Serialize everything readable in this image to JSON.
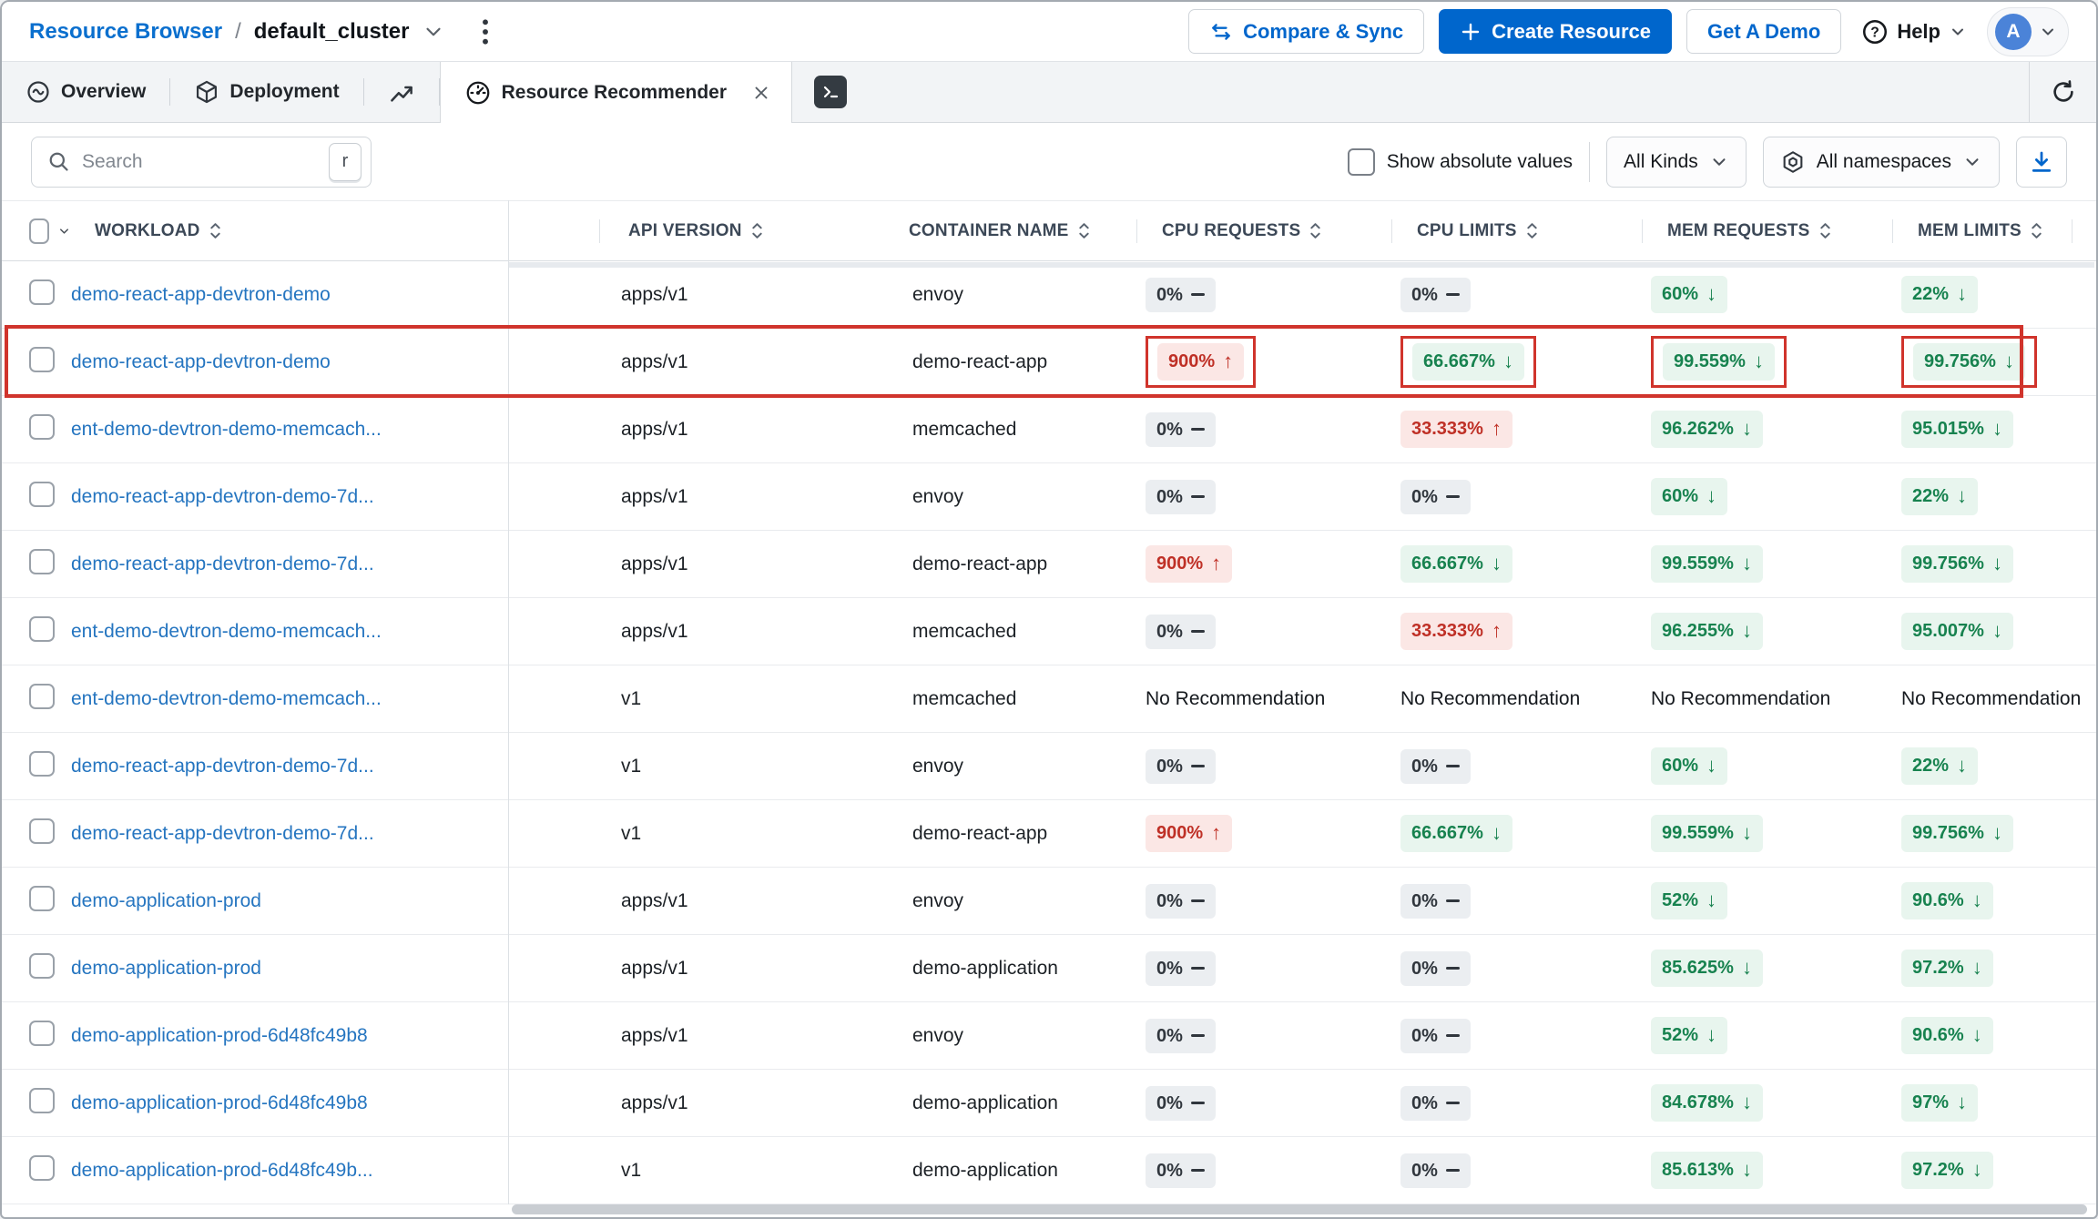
{
  "topbar": {
    "breadcrumb": {
      "root": "Resource Browser",
      "separator": "/",
      "current": "default_cluster"
    },
    "compare_sync_label": "Compare & Sync",
    "create_resource_label": "Create Resource",
    "get_demo_label": "Get A Demo",
    "help_label": "Help",
    "avatar_initial": "A"
  },
  "tabs": {
    "overview": "Overview",
    "deployment": "Deployment",
    "recommender": "Resource Recommender"
  },
  "filters": {
    "search_placeholder": "Search",
    "search_shortcut_key": "r",
    "show_absolute_values_label": "Show absolute values",
    "kinds_dropdown": "All Kinds",
    "namespaces_dropdown": "All namespaces"
  },
  "table": {
    "columns": [
      "WORKLOAD",
      "API VERSION",
      "CONTAINER NAME",
      "CPU REQUESTS",
      "CPU LIMITS",
      "MEM REQUESTS",
      "MEM LIMITS"
    ],
    "no_recommendation_label": "No Recommendation",
    "rows": [
      {
        "workload": "demo-react-app-devtron-demo",
        "api_version": "apps/v1",
        "container": "envoy",
        "cpu_requests": {
          "v": "0%",
          "t": "flat"
        },
        "cpu_limits": {
          "v": "0%",
          "t": "flat"
        },
        "mem_requests": {
          "v": "60%",
          "t": "down"
        },
        "mem_limits": {
          "v": "22%",
          "t": "down"
        },
        "highlighted": false
      },
      {
        "workload": "demo-react-app-devtron-demo",
        "api_version": "apps/v1",
        "container": "demo-react-app",
        "cpu_requests": {
          "v": "900%",
          "t": "up"
        },
        "cpu_limits": {
          "v": "66.667%",
          "t": "down"
        },
        "mem_requests": {
          "v": "99.559%",
          "t": "down"
        },
        "mem_limits": {
          "v": "99.756%",
          "t": "down"
        },
        "highlighted": true
      },
      {
        "workload": "ent-demo-devtron-demo-memcach...",
        "api_version": "apps/v1",
        "container": "memcached",
        "cpu_requests": {
          "v": "0%",
          "t": "flat"
        },
        "cpu_limits": {
          "v": "33.333%",
          "t": "up"
        },
        "mem_requests": {
          "v": "96.262%",
          "t": "down"
        },
        "mem_limits": {
          "v": "95.015%",
          "t": "down"
        },
        "highlighted": false
      },
      {
        "workload": "demo-react-app-devtron-demo-7d...",
        "api_version": "apps/v1",
        "container": "envoy",
        "cpu_requests": {
          "v": "0%",
          "t": "flat"
        },
        "cpu_limits": {
          "v": "0%",
          "t": "flat"
        },
        "mem_requests": {
          "v": "60%",
          "t": "down"
        },
        "mem_limits": {
          "v": "22%",
          "t": "down"
        },
        "highlighted": false
      },
      {
        "workload": "demo-react-app-devtron-demo-7d...",
        "api_version": "apps/v1",
        "container": "demo-react-app",
        "cpu_requests": {
          "v": "900%",
          "t": "up"
        },
        "cpu_limits": {
          "v": "66.667%",
          "t": "down"
        },
        "mem_requests": {
          "v": "99.559%",
          "t": "down"
        },
        "mem_limits": {
          "v": "99.756%",
          "t": "down"
        },
        "highlighted": false
      },
      {
        "workload": "ent-demo-devtron-demo-memcach...",
        "api_version": "apps/v1",
        "container": "memcached",
        "cpu_requests": {
          "v": "0%",
          "t": "flat"
        },
        "cpu_limits": {
          "v": "33.333%",
          "t": "up"
        },
        "mem_requests": {
          "v": "96.255%",
          "t": "down"
        },
        "mem_limits": {
          "v": "95.007%",
          "t": "down"
        },
        "highlighted": false
      },
      {
        "workload": "ent-demo-devtron-demo-memcach...",
        "api_version": "v1",
        "container": "memcached",
        "cpu_requests": {
          "v": "",
          "t": "none"
        },
        "cpu_limits": {
          "v": "",
          "t": "none"
        },
        "mem_requests": {
          "v": "",
          "t": "none"
        },
        "mem_limits": {
          "v": "",
          "t": "none"
        },
        "highlighted": false
      },
      {
        "workload": "demo-react-app-devtron-demo-7d...",
        "api_version": "v1",
        "container": "envoy",
        "cpu_requests": {
          "v": "0%",
          "t": "flat"
        },
        "cpu_limits": {
          "v": "0%",
          "t": "flat"
        },
        "mem_requests": {
          "v": "60%",
          "t": "down"
        },
        "mem_limits": {
          "v": "22%",
          "t": "down"
        },
        "highlighted": false
      },
      {
        "workload": "demo-react-app-devtron-demo-7d...",
        "api_version": "v1",
        "container": "demo-react-app",
        "cpu_requests": {
          "v": "900%",
          "t": "up"
        },
        "cpu_limits": {
          "v": "66.667%",
          "t": "down"
        },
        "mem_requests": {
          "v": "99.559%",
          "t": "down"
        },
        "mem_limits": {
          "v": "99.756%",
          "t": "down"
        },
        "highlighted": false
      },
      {
        "workload": "demo-application-prod",
        "api_version": "apps/v1",
        "container": "envoy",
        "cpu_requests": {
          "v": "0%",
          "t": "flat"
        },
        "cpu_limits": {
          "v": "0%",
          "t": "flat"
        },
        "mem_requests": {
          "v": "52%",
          "t": "down"
        },
        "mem_limits": {
          "v": "90.6%",
          "t": "down"
        },
        "highlighted": false
      },
      {
        "workload": "demo-application-prod",
        "api_version": "apps/v1",
        "container": "demo-application",
        "cpu_requests": {
          "v": "0%",
          "t": "flat"
        },
        "cpu_limits": {
          "v": "0%",
          "t": "flat"
        },
        "mem_requests": {
          "v": "85.625%",
          "t": "down"
        },
        "mem_limits": {
          "v": "97.2%",
          "t": "down"
        },
        "highlighted": false
      },
      {
        "workload": "demo-application-prod-6d48fc49b8",
        "api_version": "apps/v1",
        "container": "envoy",
        "cpu_requests": {
          "v": "0%",
          "t": "flat"
        },
        "cpu_limits": {
          "v": "0%",
          "t": "flat"
        },
        "mem_requests": {
          "v": "52%",
          "t": "down"
        },
        "mem_limits": {
          "v": "90.6%",
          "t": "down"
        },
        "highlighted": false
      },
      {
        "workload": "demo-application-prod-6d48fc49b8",
        "api_version": "apps/v1",
        "container": "demo-application",
        "cpu_requests": {
          "v": "0%",
          "t": "flat"
        },
        "cpu_limits": {
          "v": "0%",
          "t": "flat"
        },
        "mem_requests": {
          "v": "84.678%",
          "t": "down"
        },
        "mem_limits": {
          "v": "97%",
          "t": "down"
        },
        "highlighted": false
      },
      {
        "workload": "demo-application-prod-6d48fc49b...",
        "api_version": "v1",
        "container": "demo-application",
        "cpu_requests": {
          "v": "0%",
          "t": "flat"
        },
        "cpu_limits": {
          "v": "0%",
          "t": "flat"
        },
        "mem_requests": {
          "v": "85.613%",
          "t": "down"
        },
        "mem_limits": {
          "v": "97.2%",
          "t": "down"
        },
        "highlighted": false
      }
    ]
  },
  "icons": {
    "trend_up": "↑",
    "trend_down": "↓",
    "trend_flat": "—",
    "search": "magnifier",
    "sort": "up-down-chevrons",
    "more_options": "kebab-dots",
    "close": "x-cross"
  },
  "colors": {
    "primary_blue": "#0066cc",
    "link_blue": "#2575c0",
    "trend_up_red": "#bf3026",
    "trend_down_green": "#17824f",
    "neutral_badge_bg": "#ebeef1",
    "annotation_red": "#d0342c"
  }
}
